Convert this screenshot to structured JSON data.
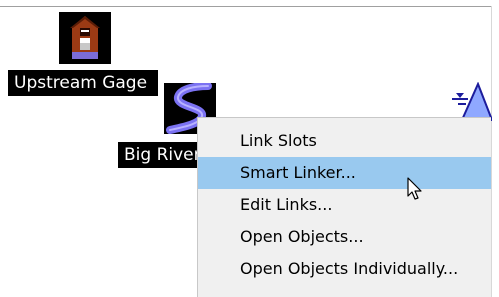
{
  "canvas": {
    "nodes": [
      {
        "label": "Upstream Gage",
        "icon": "gage-house-icon"
      },
      {
        "label": "Big River",
        "icon": "river-reach-icon"
      },
      {
        "label": "",
        "icon": "reservoir-triangle-icon"
      }
    ]
  },
  "context_menu": {
    "items": [
      {
        "label": "Link Slots",
        "state": "normal"
      },
      {
        "label": "Smart Linker...",
        "state": "hovered"
      },
      {
        "label": "Edit Links...",
        "state": "normal"
      },
      {
        "label": "Open Objects...",
        "state": "normal"
      },
      {
        "label": "Open Objects Individually...",
        "state": "normal"
      }
    ],
    "highlight_color": "#99c9ef"
  },
  "cursor": {
    "icon": "arrow-pointer-icon"
  }
}
